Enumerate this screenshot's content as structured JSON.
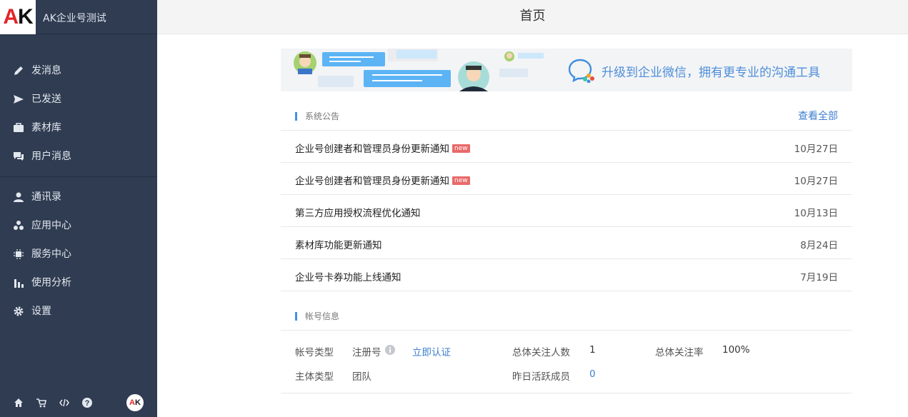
{
  "app": {
    "logo_text": "AK",
    "org_name": "AK企业号测试",
    "page_title": "首页"
  },
  "sidebar": {
    "group1": [
      {
        "label": "发消息",
        "icon": "pencil-icon"
      },
      {
        "label": "已发送",
        "icon": "send-icon"
      },
      {
        "label": "素材库",
        "icon": "briefcase-icon"
      },
      {
        "label": "用户消息",
        "icon": "chat-icon"
      }
    ],
    "group2": [
      {
        "label": "通讯录",
        "icon": "user-icon"
      },
      {
        "label": "应用中心",
        "icon": "apps-icon"
      },
      {
        "label": "服务中心",
        "icon": "chip-icon"
      },
      {
        "label": "使用分析",
        "icon": "bar-chart-icon"
      },
      {
        "label": "设置",
        "icon": "gear-icon"
      }
    ],
    "footer_icons": [
      "home-icon",
      "cart-icon",
      "code-icon",
      "help-icon"
    ],
    "avatar_text": "AK"
  },
  "banner": {
    "text": "升级到企业微信，拥有更专业的沟通工具"
  },
  "announcements": {
    "title": "系统公告",
    "view_all": "查看全部",
    "items": [
      {
        "title": "企业号创建者和管理员身份更新通知",
        "badge": "new",
        "date": "10月27日"
      },
      {
        "title": "企业号创建者和管理员身份更新通知",
        "badge": "new",
        "date": "10月27日"
      },
      {
        "title": "第三方应用授权流程优化通知",
        "badge": "",
        "date": "10月13日"
      },
      {
        "title": "素材库功能更新通知",
        "badge": "",
        "date": "8月24日"
      },
      {
        "title": "企业号卡券功能上线通知",
        "badge": "",
        "date": "7月19日"
      }
    ]
  },
  "account": {
    "title": "帐号信息",
    "account_type_label": "帐号类型",
    "account_type_value": "注册号",
    "verify_link": "立即认证",
    "entity_type_label": "主体类型",
    "entity_type_value": "团队",
    "total_followers_label": "总体关注人数",
    "total_followers_value": "1",
    "follow_rate_label": "总体关注率",
    "follow_rate_value": "100%",
    "active_yesterday_label": "昨日活跃成员",
    "active_yesterday_value": "0"
  },
  "colors": {
    "sidebar_bg": "#2f3c51",
    "accent": "#4a90e2",
    "link": "#3d7fcf",
    "badge": "#e96a6a"
  }
}
